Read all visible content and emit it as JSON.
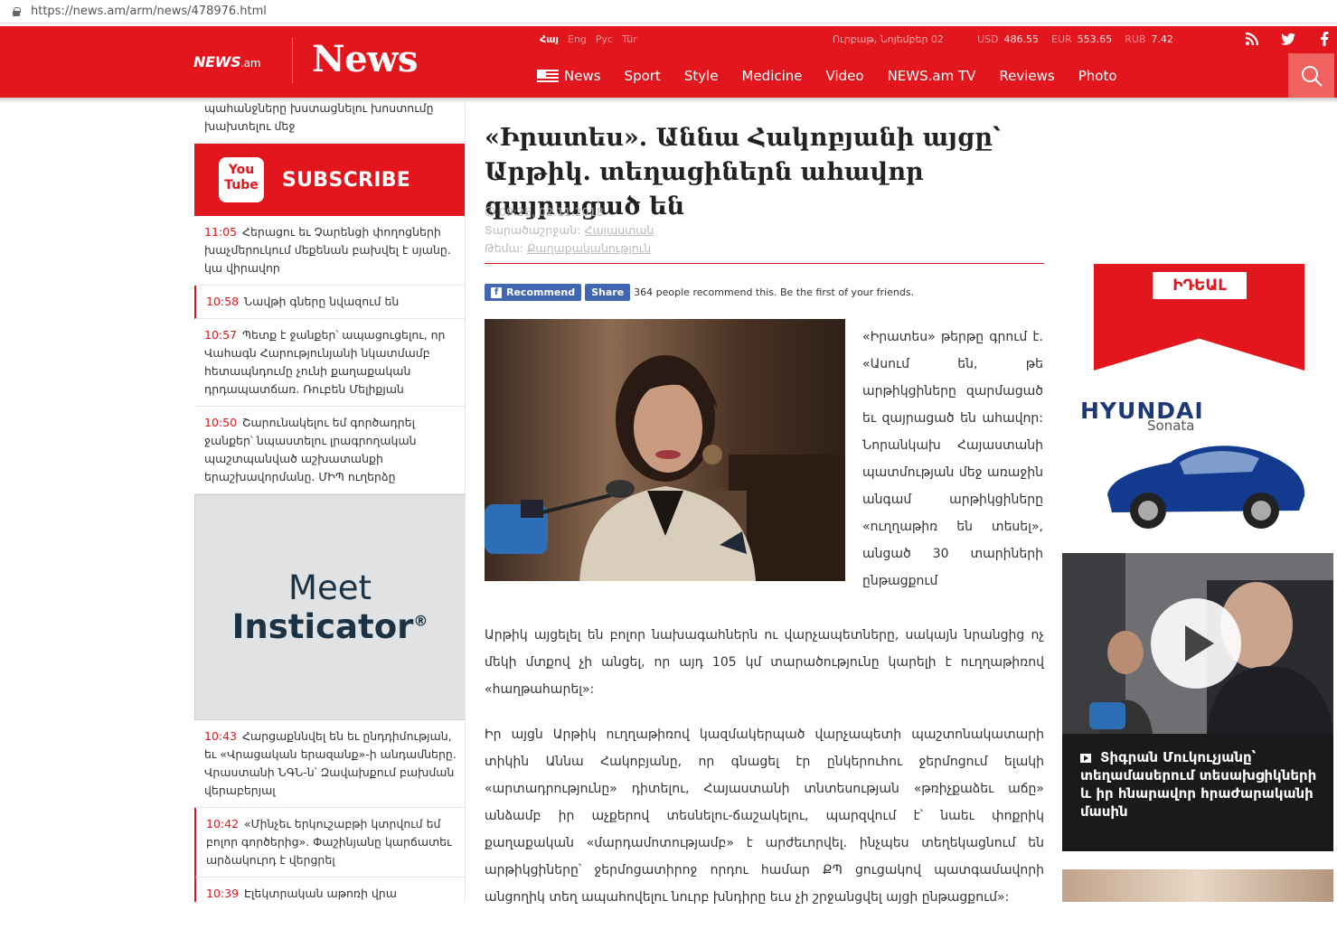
{
  "browser": {
    "url": "https://news.am/arm/news/478976.html"
  },
  "header": {
    "logo_small": "NEWS",
    "logo_small_suffix": ".am",
    "logo_big": "News",
    "languages": [
      {
        "label": "Հայ",
        "active": true
      },
      {
        "label": "Eng",
        "active": false
      },
      {
        "label": "Рус",
        "active": false
      },
      {
        "label": "Tür",
        "active": false
      }
    ],
    "date": "Ուրբաթ, Նոյեմբեր 02",
    "rates": [
      {
        "cur": "USD",
        "val": "486.55"
      },
      {
        "cur": "EUR",
        "val": "553.65"
      },
      {
        "cur": "RUB",
        "val": "7.42"
      }
    ],
    "nav": [
      "News",
      "Sport",
      "Style",
      "Medicine",
      "Video",
      "NEWS.am TV",
      "Reviews",
      "Photo"
    ]
  },
  "sidebar": {
    "top_item_text": "պահանջները խստացնելու խոստումը խախտելու մեջ",
    "subscribe": {
      "logo_line1": "You",
      "logo_line2": "Tube",
      "label": "SUBSCRIBE"
    },
    "news_before": [
      {
        "time": "11:05",
        "text": "Հերացու եւ Չարենցի փողոցների խաչմերուկում մեքենան բախվել է սյանը. կա վիրավոր"
      },
      {
        "time": "10:58",
        "text": "Նավթի գները նվազում են"
      },
      {
        "time": "10:57",
        "text": "Պետք է ջանքեր՝ ապացուցելու, որ Վահագն Հարությունյանի նկատմամբ հետապնդումը չունի քաղաքական դրդապատճառ. Ռուբեն Մելիքյան"
      },
      {
        "time": "10:50",
        "text": "Շարունակելու եմ գործադրել ջանքեր՝ նպաստելու լրագրողական պաշտպանված աշխատանքի երաշխավորմանը. ՄԻՊ ուղերձը"
      }
    ],
    "ad": {
      "line1": "Meet",
      "line2": "Insticator",
      "mark": "®"
    },
    "news_after": [
      {
        "time": "10:43",
        "text": "Հարցաքննվել են եւ ընդդիմության, եւ «Վրացական երազանք»-ի անդամները. Վրաստանի ՆԳՆ-ն՝ Զավախքում բախման վերաբերյալ"
      },
      {
        "time": "10:42",
        "text": "«Մինչեւ երկուշաբթի կտրվում եմ բոլոր գործերից». Փաշինյանը կարճատեւ արձակուրդ է վերցրել"
      },
      {
        "time": "10:39",
        "text": "Էլեկտրական աթոռի վրա"
      }
    ]
  },
  "article": {
    "title": "«Իրատես». Աննա Հակոբյանի այցը՝ Արթիկ. տեղացիներն ահավոր զայրացած են",
    "time": "09:26, 02.11.2018",
    "region_label": "Տարածաշրջան:",
    "region": "Հայաստան",
    "topic_label": "Թեմա:",
    "topic": "Քաղաքականություն",
    "fb": {
      "recommend": "Recommend",
      "share": "Share",
      "text": "364 people recommend this. Be the first of your friends."
    },
    "float_text": "«Իրատես» թերթը գրում է. «Ասում են, թե արթիկցիները զարմացած եւ զայրացած են ահավոր: Նորանկախ Հայաստանի պատմության մեջ առաջին անգամ արթիկցիները «ուղղաթիռ են տեսել», անցած 30 տարիների ընթացքում",
    "para1_tail": "Արթիկ այցելել են բոլոր նախագահներն ու վարչապետները, սակայն նրանցից ոչ մեկի մտքով չի անցել, որ այդ 105 կմ տարածությունը կարելի է ուղղաթիռով «հաղթահարել»:",
    "para2": "Իր այցն Արթիկ ուղղաթիռով կազմակերպած վարչապետի պաշտոնակատարի տիկին Աննա Հակոբյանը, որ գնացել էր ընկերուհու ջերմոցում ելակի «արտադրությունը» դիտելու, Հայաստանի տնտեսության «թռիչքաձեւ աճը» անձամբ իր աչքերով տեսնելու-ճաշակելու, պարզվում է՝ նաեւ փոքրիկ քաղաքական «մարդամոտությամբ» է արժեւորվել. ինչպես տեղեկացնում են արթիկցիները՝ ջերմոցատիրոջ որդու համար ՔՊ ցուցակով պատգամավորի անցողիկ տեղ ապահովելու նուրբ խնդիրը եւս չի շրջանցվել այցի ընթացքում»:"
  },
  "right": {
    "ad": {
      "brand_box": "ԻԴԵԱԼ",
      "make": "HYUNDAI",
      "model": "Sonata"
    },
    "video_caption": "Տիգրան Մուկուչյանը՝ տեղամասերում տեսախցիկների և իր հնարավոր հրաժարականի մասին"
  }
}
